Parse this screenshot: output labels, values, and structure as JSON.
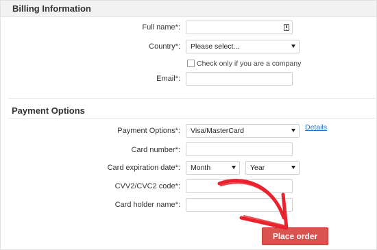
{
  "billing": {
    "title": "Billing Information",
    "full_name_label": "Full name*:",
    "country_label": "Country*:",
    "country_value": "Please select...",
    "company_checkbox_label": "Check only if you are a company",
    "email_label": "Email*:"
  },
  "payment": {
    "title": "Payment Options",
    "options_label": "Payment Options*:",
    "options_value": "Visa/MasterCard",
    "details_link": "Details",
    "card_number_label": "Card number*:",
    "expiration_label": "Card expiration date*:",
    "month_value": "Month",
    "year_value": "Year",
    "cvv_label": "CVV2/CVC2 code*:",
    "holder_label": "Card holder name*:"
  },
  "place_order_label": "Place order",
  "colors": {
    "button": "#d9534f",
    "arrow": "#e8232d",
    "link": "#2a6ebb"
  },
  "icons": [
    "autofill-icon",
    "chevron-down-icon",
    "annotation-arrow-icon"
  ]
}
